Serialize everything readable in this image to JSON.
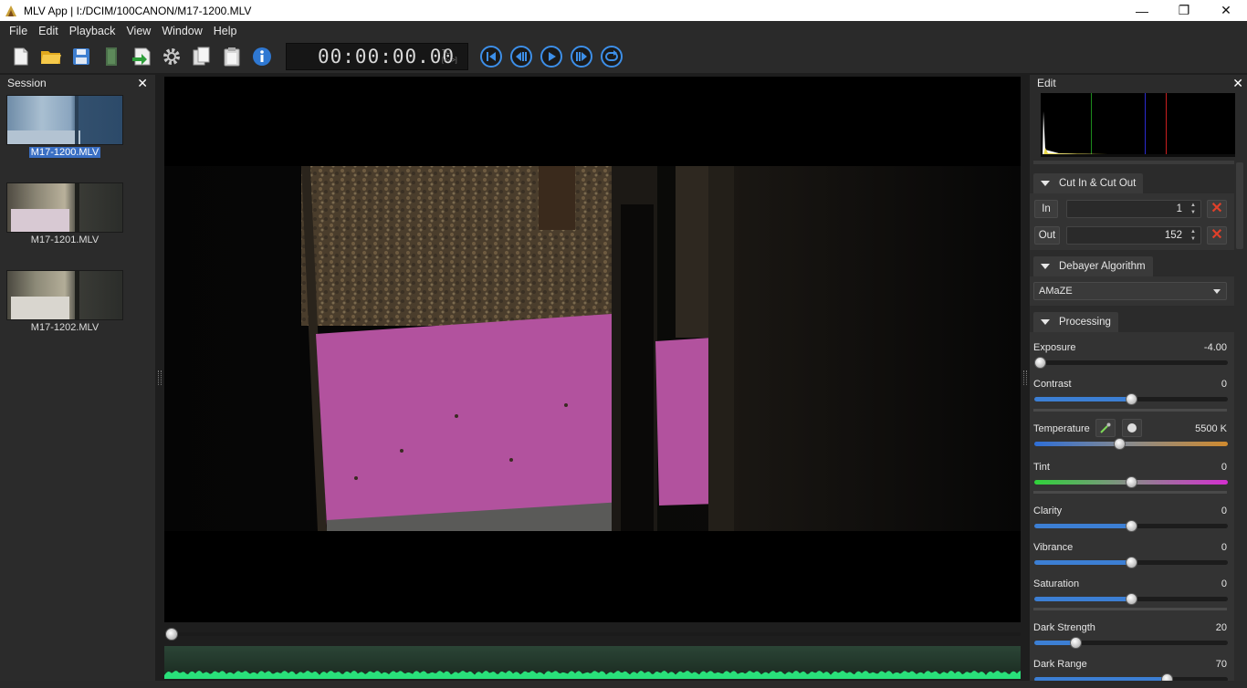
{
  "window": {
    "title": "MLV App | I:/DCIM/100CANON/M17-1200.MLV",
    "minimize_glyph": "—",
    "restore_glyph": "❐",
    "close_glyph": "✕"
  },
  "menu": [
    "File",
    "Edit",
    "Playback",
    "View",
    "Window",
    "Help"
  ],
  "toolbar": {
    "icons": [
      "new-session-icon",
      "open-folder-icon",
      "save-icon",
      "export-disk-icon",
      "export-arrow-icon",
      "settings-gear-icon",
      "copy-icon",
      "paste-icon",
      "info-icon"
    ],
    "timecode": "00:00:00.00",
    "tc_label_top": "TC",
    "tc_label_bottom": "[<-->]",
    "transport": [
      "skip-to-start-icon",
      "step-back-icon",
      "play-icon",
      "step-forward-icon",
      "loop-icon"
    ]
  },
  "session": {
    "title": "Session",
    "close_glyph": "✕",
    "clips": [
      {
        "name": "M17-1200.MLV",
        "selected": true
      },
      {
        "name": "M17-1201.MLV",
        "selected": false
      },
      {
        "name": "M17-1202.MLV",
        "selected": false
      }
    ]
  },
  "edit": {
    "title": "Edit",
    "close_glyph": "✕",
    "cut": {
      "section": "Cut In & Cut Out",
      "in_label": "In",
      "in_value": "1",
      "out_label": "Out",
      "out_value": "152"
    },
    "debayer": {
      "section": "Debayer Algorithm",
      "selected": "AMaZE"
    },
    "processing": {
      "section": "Processing",
      "exposure": {
        "label": "Exposure",
        "value": "-4.00",
        "position": 0.0
      },
      "contrast": {
        "label": "Contrast",
        "value": "0",
        "position": 0.5
      },
      "temperature": {
        "label": "Temperature",
        "value": "5500 K",
        "position": 0.44
      },
      "tint": {
        "label": "Tint",
        "value": "0",
        "position": 0.5
      },
      "clarity": {
        "label": "Clarity",
        "value": "0",
        "position": 0.5
      },
      "vibrance": {
        "label": "Vibrance",
        "value": "0",
        "position": 0.5
      },
      "saturation": {
        "label": "Saturation",
        "value": "0",
        "position": 0.5
      },
      "dark_strength": {
        "label": "Dark Strength",
        "value": "20",
        "position": 0.2
      },
      "dark_range": {
        "label": "Dark Range",
        "value": "70",
        "position": 0.7
      }
    }
  },
  "colors": {
    "accent": "#3c7fd4",
    "selection": "#3a6fc4",
    "magenta": "#b2529e",
    "cancel_red": "#e0402a"
  }
}
